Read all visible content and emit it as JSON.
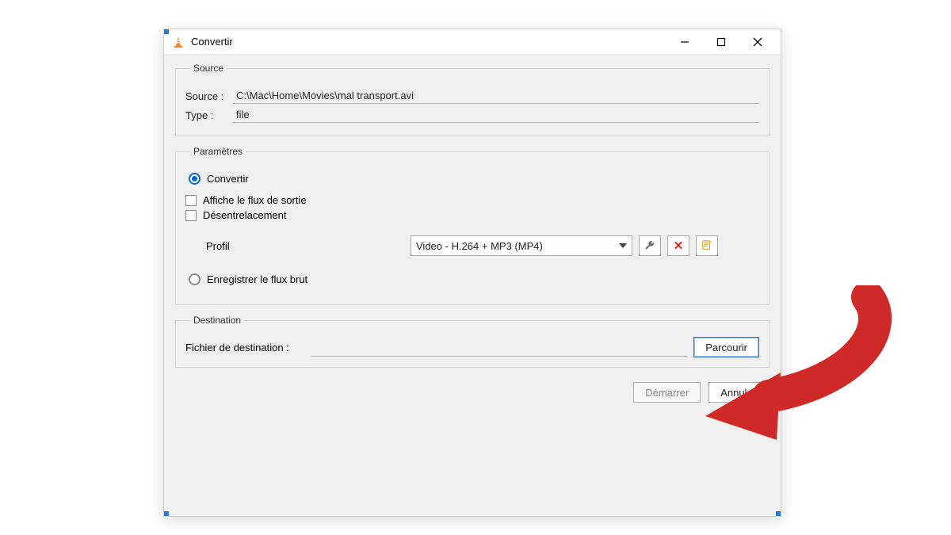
{
  "window": {
    "title": "Convertir"
  },
  "source": {
    "legend": "Source",
    "source_label": "Source :",
    "source_value": "C:\\Mac\\Home\\Movies\\mal transport.avi",
    "type_label": "Type :",
    "type_value": "file"
  },
  "params": {
    "legend": "Paramètres",
    "convert_label": "Convertir",
    "show_output_label": "Affiche le flux de sortie",
    "deinterlace_label": "Désentrelacement",
    "profile_label": "Profil",
    "profile_value": "Video - H.264 + MP3 (MP4)",
    "raw_label": "Enregistrer le flux brut"
  },
  "destination": {
    "legend": "Destination",
    "file_label": "Fichier de destination :",
    "file_value": "",
    "browse_label": "Parcourir"
  },
  "footer": {
    "start_label": "Démarrer",
    "cancel_label": "Annuler"
  }
}
